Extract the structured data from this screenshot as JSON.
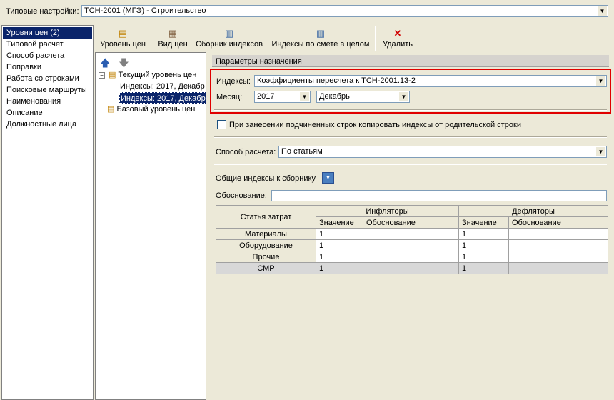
{
  "top": {
    "label": "Типовые настройки:",
    "value": "ТСН-2001 (МГЭ) - Строительство"
  },
  "nav": {
    "items": [
      {
        "label": "Уровни цен (2)",
        "selected": true
      },
      {
        "label": "Типовой расчет"
      },
      {
        "label": "Способ расчета"
      },
      {
        "label": "Поправки"
      },
      {
        "label": "Работа со строками"
      },
      {
        "label": "Поисковые маршруты"
      },
      {
        "label": "Наименования"
      },
      {
        "label": "Описание"
      },
      {
        "label": "Должностные лица"
      }
    ]
  },
  "toolbar": {
    "price_level": "Уровень цен",
    "price_view": "Вид цен",
    "index_collection": "Сборник индексов",
    "indexes_whole": "Индексы по смете в целом",
    "delete": "Удалить"
  },
  "tree": {
    "current_level": "Текущий уровень цен",
    "idx1": "Индексы: 2017, Декабр",
    "idx2": "Индексы: 2017, Декабр",
    "base_level": "Базовый уровень цен"
  },
  "params": {
    "header": "Параметры назначения",
    "indexes_label": "Индексы:",
    "indexes_value": "Коэффициенты пересчета к ТСН-2001.13-2",
    "month_label": "Месяц:",
    "year_value": "2017",
    "month_value": "Декабрь",
    "copy_checkbox_label": "При занесении подчиненных строк копировать индексы от родительской строки",
    "copy_checked": false,
    "calc_method_label": "Способ расчета:",
    "calc_method_value": "По статьям",
    "common_indexes_label": "Общие индексы к сборнику",
    "basis_label": "Обоснование:",
    "basis_value": ""
  },
  "grid": {
    "cost_article": "Статья затрат",
    "inflators": "Инфляторы",
    "deflators": "Дефляторы",
    "value": "Значение",
    "basis": "Обоснование",
    "rows": [
      {
        "name": "Материалы",
        "inf_value": "1",
        "inf_basis": "",
        "def_value": "1",
        "def_basis": ""
      },
      {
        "name": "Оборудование",
        "inf_value": "1",
        "inf_basis": "",
        "def_value": "1",
        "def_basis": ""
      },
      {
        "name": "Прочие",
        "inf_value": "1",
        "inf_basis": "",
        "def_value": "1",
        "def_basis": ""
      },
      {
        "name": "СМР",
        "inf_value": "1",
        "inf_basis": "",
        "def_value": "1",
        "def_basis": ""
      }
    ]
  },
  "colors": {
    "highlight_border": "#e00000",
    "selection": "#0a246a"
  }
}
